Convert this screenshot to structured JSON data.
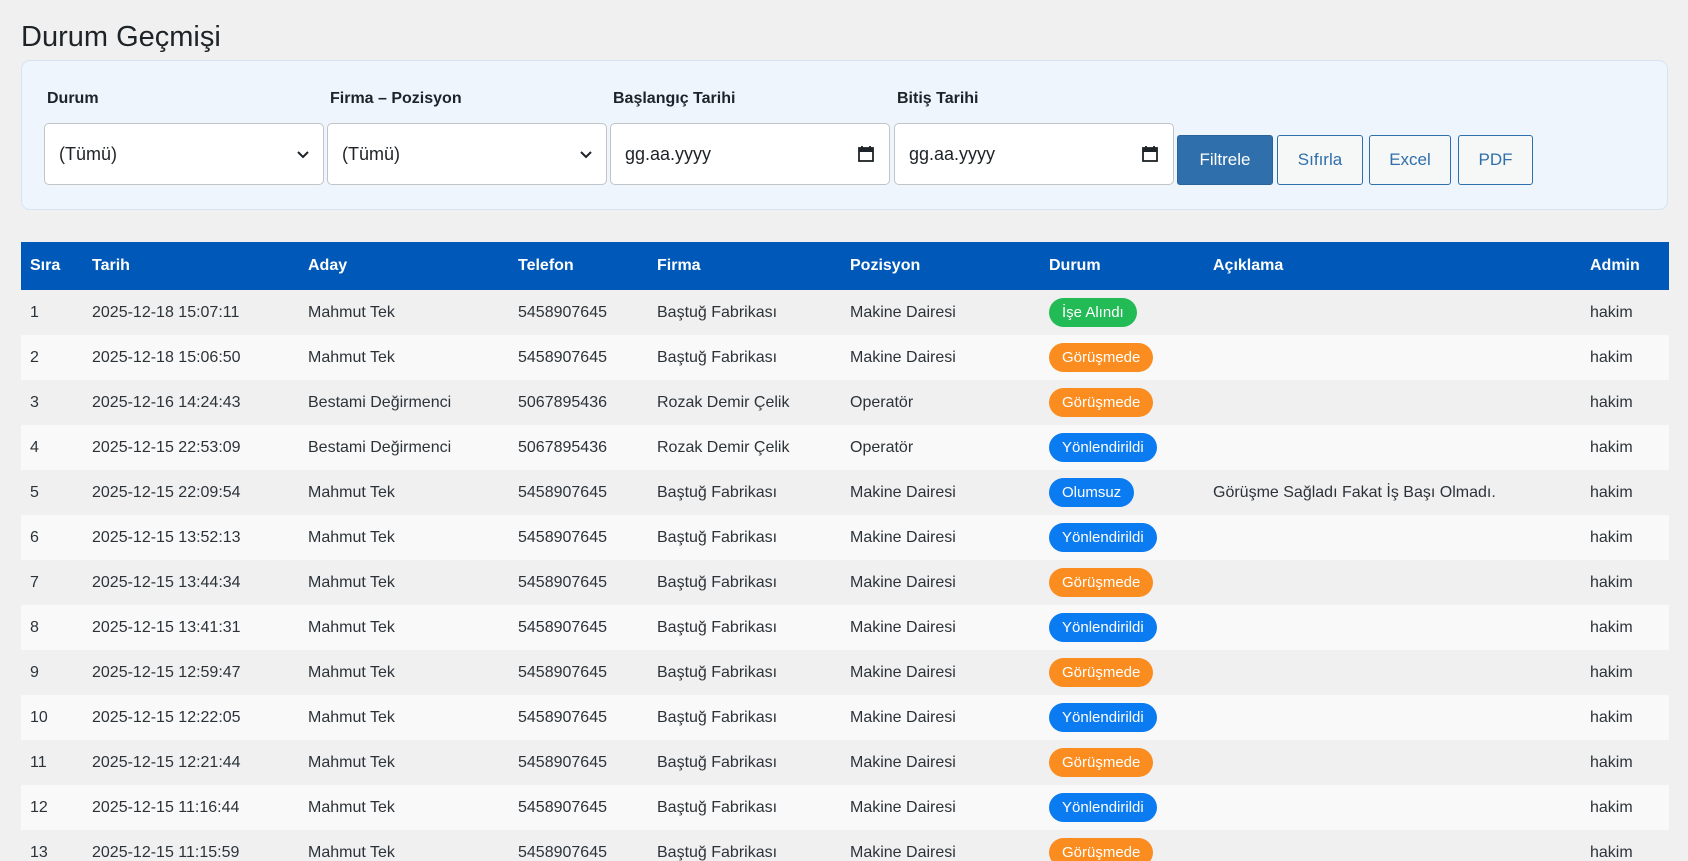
{
  "page": {
    "title": "Durum Geçmişi"
  },
  "filters": {
    "status": {
      "label": "Durum",
      "value": "(Tümü)"
    },
    "company_position": {
      "label": "Firma – Pozisyon",
      "value": "(Tümü)"
    },
    "start_date": {
      "label": "Başlangıç Tarihi",
      "placeholder": "gg.aa.yyyy"
    },
    "end_date": {
      "label": "Bitiş Tarihi",
      "placeholder": "gg.aa.yyyy"
    },
    "buttons": {
      "filter": "Filtrele",
      "reset": "Sıfırla",
      "excel": "Excel",
      "pdf": "PDF"
    }
  },
  "table": {
    "headers": [
      "Sıra",
      "Tarih",
      "Aday",
      "Telefon",
      "Firma",
      "Pozisyon",
      "Durum",
      "Açıklama",
      "Admin"
    ],
    "rows": [
      [
        "1",
        "2025-12-18 15:07:11",
        "Mahmut Tek",
        "5458907645",
        "Baştuğ Fabrikası",
        "Makine Dairesi",
        "İşe Alındı",
        "",
        "hakim"
      ],
      [
        "2",
        "2025-12-18 15:06:50",
        "Mahmut Tek",
        "5458907645",
        "Baştuğ Fabrikası",
        "Makine Dairesi",
        "Görüşmede",
        "",
        "hakim"
      ],
      [
        "3",
        "2025-12-16 14:24:43",
        "Bestami Değirmenci",
        "5067895436",
        "Rozak Demir Çelik",
        "Operatör",
        "Görüşmede",
        "",
        "hakim"
      ],
      [
        "4",
        "2025-12-15 22:53:09",
        "Bestami Değirmenci",
        "5067895436",
        "Rozak Demir Çelik",
        "Operatör",
        "Yönlendirildi",
        "",
        "hakim"
      ],
      [
        "5",
        "2025-12-15 22:09:54",
        "Mahmut Tek",
        "5458907645",
        "Baştuğ Fabrikası",
        "Makine Dairesi",
        "Olumsuz",
        "Görüşme Sağladı Fakat İş Başı Olmadı.",
        "hakim"
      ],
      [
        "6",
        "2025-12-15 13:52:13",
        "Mahmut Tek",
        "5458907645",
        "Baştuğ Fabrikası",
        "Makine Dairesi",
        "Yönlendirildi",
        "",
        "hakim"
      ],
      [
        "7",
        "2025-12-15 13:44:34",
        "Mahmut Tek",
        "5458907645",
        "Baştuğ Fabrikası",
        "Makine Dairesi",
        "Görüşmede",
        "",
        "hakim"
      ],
      [
        "8",
        "2025-12-15 13:41:31",
        "Mahmut Tek",
        "5458907645",
        "Baştuğ Fabrikası",
        "Makine Dairesi",
        "Yönlendirildi",
        "",
        "hakim"
      ],
      [
        "9",
        "2025-12-15 12:59:47",
        "Mahmut Tek",
        "5458907645",
        "Baştuğ Fabrikası",
        "Makine Dairesi",
        "Görüşmede",
        "",
        "hakim"
      ],
      [
        "10",
        "2025-12-15 12:22:05",
        "Mahmut Tek",
        "5458907645",
        "Baştuğ Fabrikası",
        "Makine Dairesi",
        "Yönlendirildi",
        "",
        "hakim"
      ],
      [
        "11",
        "2025-12-15 12:21:44",
        "Mahmut Tek",
        "5458907645",
        "Baştuğ Fabrikası",
        "Makine Dairesi",
        "Görüşmede",
        "",
        "hakim"
      ],
      [
        "12",
        "2025-12-15 11:16:44",
        "Mahmut Tek",
        "5458907645",
        "Baştuğ Fabrikası",
        "Makine Dairesi",
        "Yönlendirildi",
        "",
        "hakim"
      ],
      [
        "13",
        "2025-12-15 11:15:59",
        "Mahmut Tek",
        "5458907645",
        "Baştuğ Fabrikası",
        "Makine Dairesi",
        "Görüşmede",
        "",
        "hakim"
      ]
    ]
  },
  "status_colors": {
    "İşe Alındı": "#22bb55",
    "Görüşmede": "#fb8c1f",
    "Yönlendirildi": "#0a7bf0",
    "Olumsuz": "#0a7bf0"
  },
  "colors": {
    "header_bg": "#0059b8",
    "primary_button": "#2f6fab"
  },
  "icons": {
    "dropdown": "chevron-down-icon",
    "date": "calendar-icon"
  }
}
